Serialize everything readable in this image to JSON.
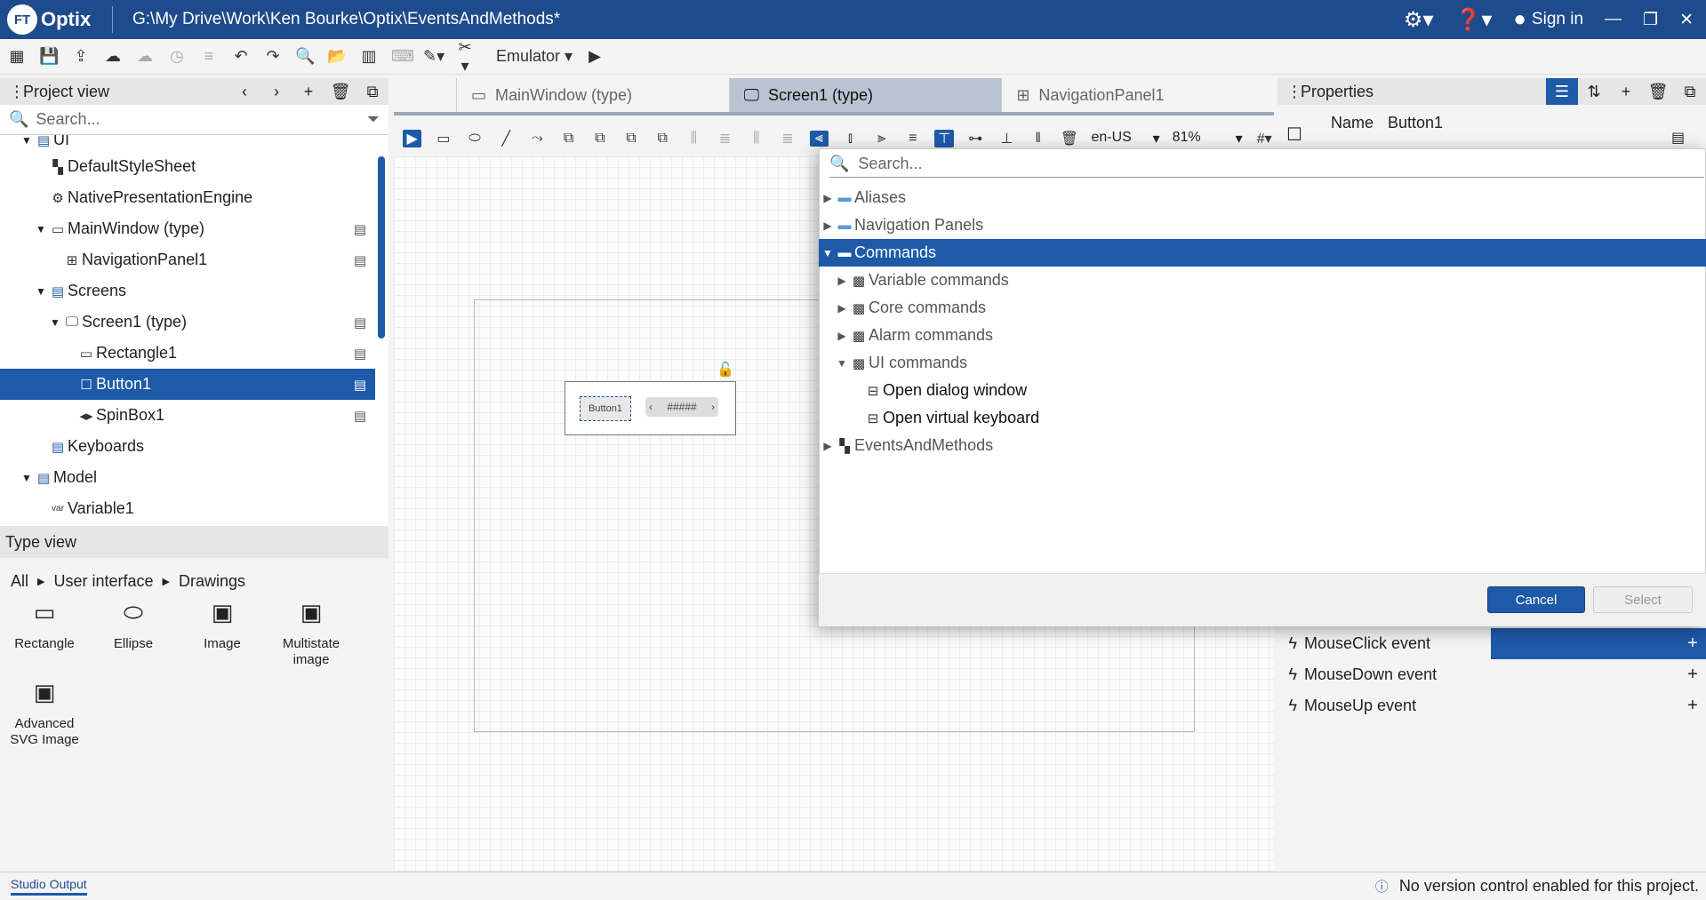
{
  "app": {
    "logo_badge": "FT",
    "logo_text": "Optix",
    "window_title": "G:\\My Drive\\Work\\Ken Bourke\\Optix\\EventsAndMethods*",
    "sign_in": "Sign in",
    "brand_color": "#1e4b8c",
    "accent_color": "#1e5aa8"
  },
  "toolbar": {
    "emulator_label": "Emulator"
  },
  "project_view": {
    "title": "Project view",
    "search_placeholder": "Search...",
    "tree": [
      {
        "label": "UI",
        "icon": "folder-icon",
        "expanded": true
      },
      {
        "label": "DefaultStyleSheet",
        "icon": "stylesheet-icon"
      },
      {
        "label": "NativePresentationEngine",
        "icon": "gear-icon"
      },
      {
        "label": "MainWindow (type)",
        "icon": "window-icon",
        "expanded": true
      },
      {
        "label": "NavigationPanel1",
        "icon": "navpanel-icon"
      },
      {
        "label": "Screens",
        "icon": "folder-icon",
        "expanded": true
      },
      {
        "label": "Screen1 (type)",
        "icon": "monitor-icon",
        "expanded": true
      },
      {
        "label": "Rectangle1",
        "icon": "rectangle-icon"
      },
      {
        "label": "Button1",
        "icon": "button-icon",
        "selected": true
      },
      {
        "label": "SpinBox1",
        "icon": "spinbox-icon"
      },
      {
        "label": "Keyboards",
        "icon": "folder-icon"
      },
      {
        "label": "Model",
        "icon": "folder-icon",
        "expanded": true
      },
      {
        "label": "Variable1",
        "icon": "var-icon",
        "prefix": "var"
      }
    ]
  },
  "type_view": {
    "title": "Type view",
    "breadcrumb": [
      "All",
      "User interface",
      "Drawings"
    ],
    "items": [
      {
        "label": "Rectangle",
        "icon": "rectangle-icon"
      },
      {
        "label": "Ellipse",
        "icon": "ellipse-icon"
      },
      {
        "label": "Image",
        "icon": "image-icon"
      },
      {
        "label": "Multistate image",
        "icon": "image-icon"
      },
      {
        "label": "Advanced SVG Image",
        "icon": "image-icon"
      }
    ]
  },
  "editor": {
    "tabs": [
      {
        "label": "MainWindow (type)",
        "icon": "window-icon"
      },
      {
        "label": "Screen1 (type)",
        "icon": "monitor-icon",
        "active": true
      },
      {
        "label": "NavigationPanel1",
        "icon": "navpanel-icon"
      }
    ],
    "locale": "en-US",
    "zoom": "81%",
    "button_widget_text": "Button1",
    "spinbox_widget_text": "#####"
  },
  "properties": {
    "title": "Properties",
    "name_label": "Name",
    "name_value": "Button1",
    "events": [
      {
        "label": "MouseClick event",
        "selected": true
      },
      {
        "label": "MouseDown event"
      },
      {
        "label": "MouseUp event"
      }
    ]
  },
  "dialog": {
    "search_placeholder": "Search...",
    "items": [
      {
        "label": "Aliases",
        "icon": "folder-icon",
        "level": 0,
        "arrow": "collapsed"
      },
      {
        "label": "Navigation Panels",
        "icon": "folder-icon",
        "level": 0,
        "arrow": "collapsed"
      },
      {
        "label": "Commands",
        "icon": "folder-icon",
        "level": 0,
        "arrow": "expanded",
        "selected": true
      },
      {
        "label": "Variable commands",
        "icon": "library-icon",
        "level": 1,
        "arrow": "collapsed"
      },
      {
        "label": "Core commands",
        "icon": "library-icon",
        "level": 1,
        "arrow": "collapsed"
      },
      {
        "label": "Alarm commands",
        "icon": "library-icon",
        "level": 1,
        "arrow": "collapsed"
      },
      {
        "label": "UI commands",
        "icon": "library-icon",
        "level": 1,
        "arrow": "expanded"
      },
      {
        "label": "Open dialog window",
        "icon": "method-icon",
        "level": 2
      },
      {
        "label": "Open virtual keyboard",
        "icon": "method-icon",
        "level": 2
      },
      {
        "label": "EventsAndMethods",
        "icon": "nodes-icon",
        "level": 0,
        "arrow": "collapsed"
      }
    ],
    "cancel_label": "Cancel",
    "select_label": "Select"
  },
  "status": {
    "output_tab": "Studio Output",
    "message": "No version control enabled for this project."
  }
}
